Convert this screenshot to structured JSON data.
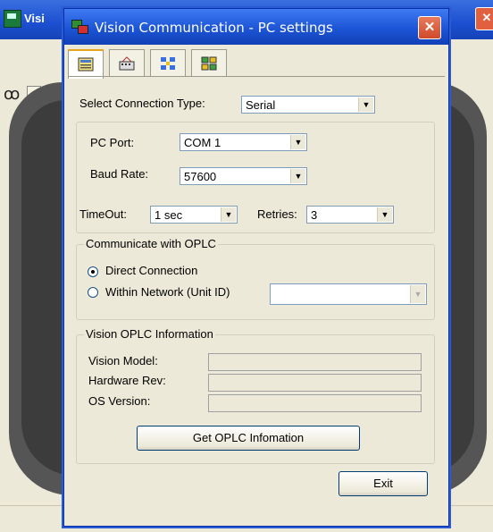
{
  "parent_window": {
    "title": "Visi"
  },
  "dialog": {
    "title": "Vision Communication - PC settings",
    "tabs": [
      {
        "icon": "settings-form-icon",
        "active": true
      },
      {
        "icon": "device-icon",
        "active": false
      },
      {
        "icon": "network-icon",
        "active": false
      },
      {
        "icon": "grid-icon",
        "active": false
      }
    ],
    "connection_type": {
      "label": "Select Connection Type:",
      "value": "Serial"
    },
    "pc_port": {
      "label": "PC Port:",
      "value": "COM 1"
    },
    "baud_rate": {
      "label": "Baud Rate:",
      "value": "57600"
    },
    "timeout": {
      "label": "TimeOut:",
      "value": "1 sec"
    },
    "retries": {
      "label": "Retries:",
      "value": "3"
    },
    "communicate": {
      "legend": "Communicate with OPLC",
      "direct": {
        "label": "Direct Connection",
        "selected": true
      },
      "network": {
        "label": "Within Network (Unit ID)",
        "selected": false,
        "value": ""
      }
    },
    "info": {
      "legend": "Vision OPLC Information",
      "model_label": "Vision Model:",
      "model_value": "",
      "hw_label": "Hardware Rev:",
      "hw_value": "",
      "os_label": "OS Version:",
      "os_value": "",
      "get_button": "Get OPLC Infomation"
    },
    "exit_button": "Exit"
  },
  "colors": {
    "titlebar": "#1c55d6",
    "close": "#cf4a2a",
    "dialog_bg": "#ece9d8"
  }
}
